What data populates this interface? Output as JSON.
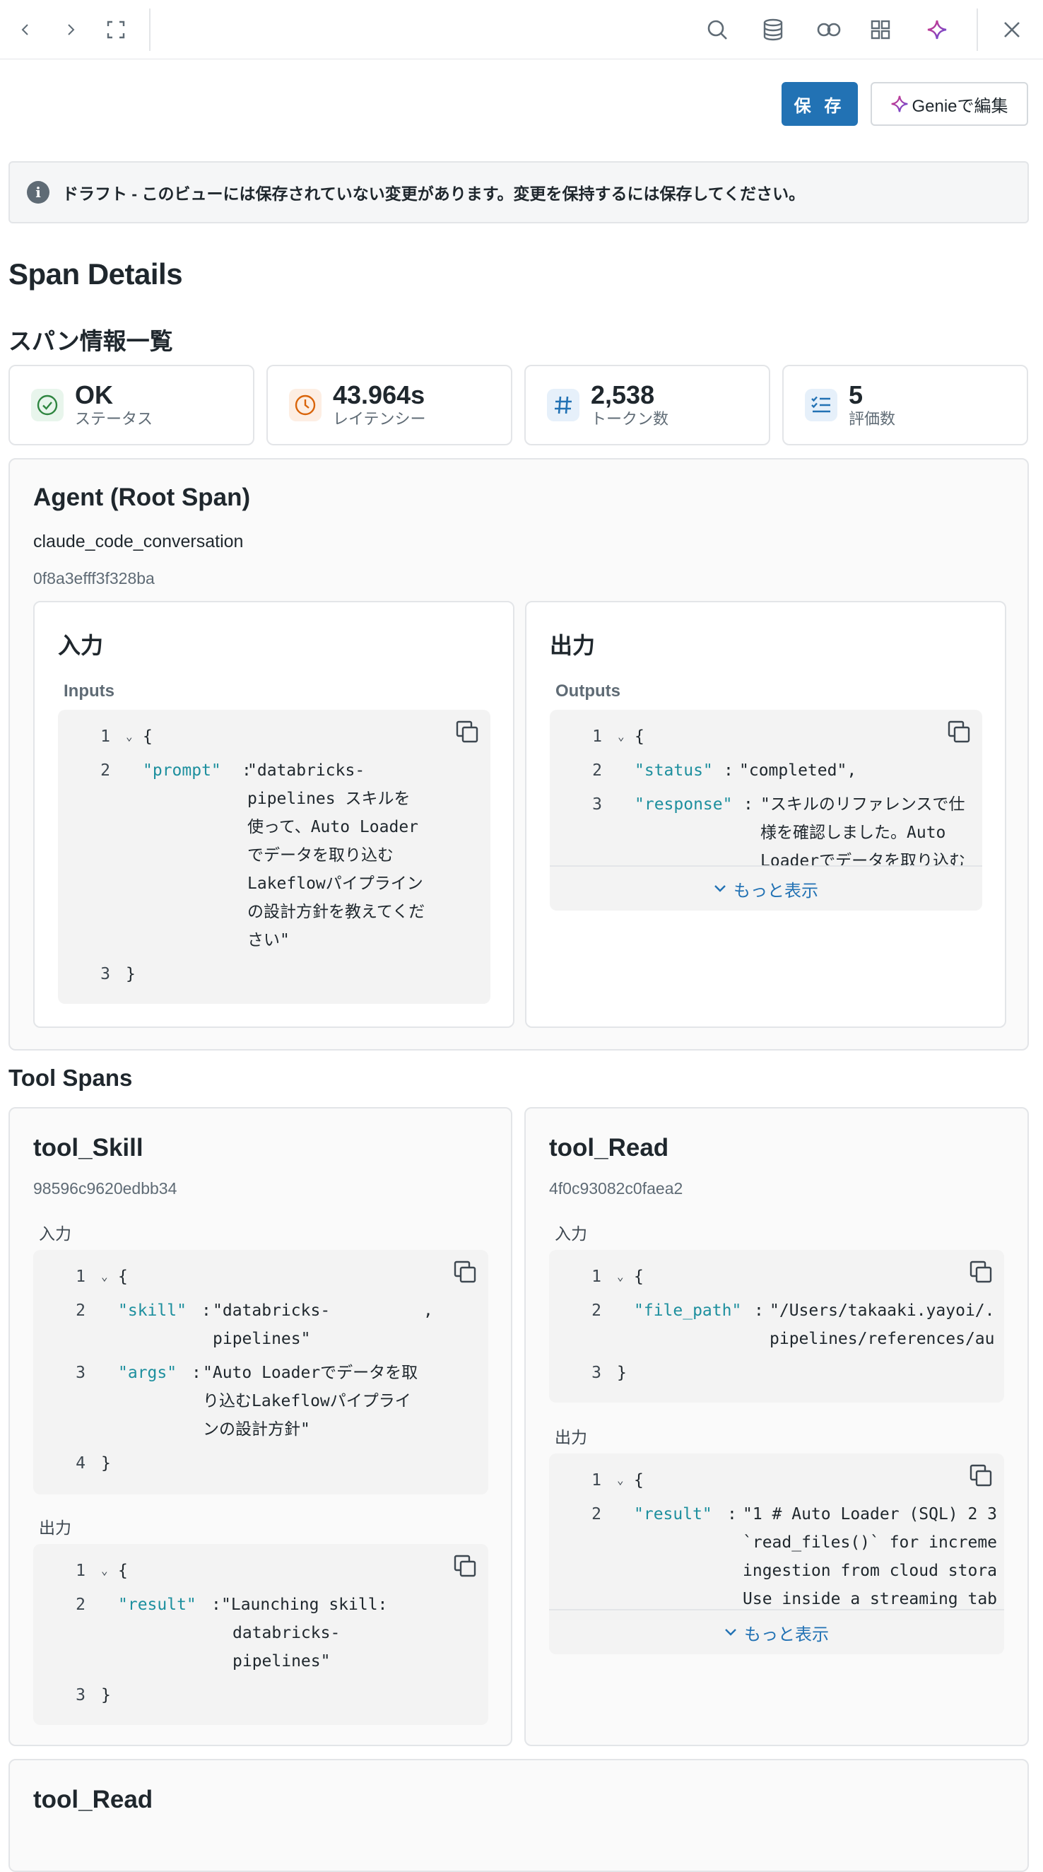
{
  "toolbar": {
    "back_icon": "chevron-left-icon",
    "forward_icon": "chevron-right-icon",
    "fullscreen_icon": "expand-icon",
    "search_icon": "search-icon",
    "database_icon": "database-icon",
    "link_icon": "link-icon",
    "grid_icon": "grid-icon",
    "sparkle_icon": "sparkle-icon",
    "close_icon": "close-icon"
  },
  "actions": {
    "save_label": "保 存",
    "genie_label": "Genieで編集"
  },
  "banner": {
    "text": "ドラフト - このビューには保存されていない変更があります。変更を保持するには保存してください。"
  },
  "page": {
    "title": "Span Details",
    "summary_heading": "スパン情報一覧",
    "tool_spans_heading": "Tool Spans"
  },
  "stats": [
    {
      "value": "OK",
      "label": "ステータス",
      "icon": "check-circle-icon",
      "color": "#2e8540"
    },
    {
      "value": "43.964s",
      "label": "レイテンシー",
      "icon": "clock-icon",
      "color": "#d9640a"
    },
    {
      "value": "2,538",
      "label": "トークン数",
      "icon": "hash-icon",
      "color": "#2272b4"
    },
    {
      "value": "5",
      "label": "評価数",
      "icon": "checklist-icon",
      "color": "#2272b4"
    }
  ],
  "root": {
    "title": "Agent (Root Span)",
    "name": "claude_code_conversation",
    "id": "0f8a3efff3f328ba",
    "input_title": "入力",
    "input_label": "Inputs",
    "output_title": "出力",
    "output_label": "Outputs",
    "input_code": {
      "l1": "{",
      "key2": "\"prompt\"",
      "val2": [
        "\"databricks-",
        "pipelines スキルを",
        "使って、Auto Loader",
        "でデータを取り込む",
        "Lakeflowパイプライン",
        "の設計方針を教えてくだ",
        "さい\""
      ],
      "l3": "}"
    },
    "output_code": {
      "l1": "{",
      "key2": "\"status\"",
      "val2": "\"completed\",",
      "key3": "\"response\"",
      "val3": [
        "\"スキルのリファレンスで仕",
        "様を確認しました。Auto",
        "Loaderでデータを取り込む"
      ],
      "more": "もっと表示"
    }
  },
  "spans": [
    {
      "title": "tool_Skill",
      "id": "98596c9620edbb34",
      "input_label": "入力",
      "output_label": "出力",
      "input_code": {
        "l1": "{",
        "key2": "\"skill\"",
        "val2": [
          "\"databricks-",
          "pipelines\""
        ],
        "comma2": ",",
        "key3": "\"args\"",
        "val3": [
          "\"Auto Loaderでデータを取",
          "り込むLakeflowパイプライ",
          "ンの設計方針\""
        ],
        "l4": "}"
      },
      "output_code": {
        "l1": "{",
        "key2": "\"result\"",
        "val2": [
          "\"Launching skill:",
          "databricks-",
          "pipelines\""
        ],
        "l3": "}"
      }
    },
    {
      "title": "tool_Read",
      "id": "4f0c93082c0faea2",
      "input_label": "入力",
      "output_label": "出力",
      "input_code": {
        "l1": "{",
        "key2": "\"file_path\"",
        "val2": [
          "\"/Users/takaaki.yayoi/.",
          "pipelines/references/au"
        ],
        "l3": "}"
      },
      "output_code": {
        "l1": "{",
        "key2": "\"result\"",
        "val2": [
          "\"1 # Auto Loader (SQL) 2 3",
          "`read_files()` for increme",
          "ingestion from cloud stora",
          "Use inside a streaming tab"
        ],
        "more": "もっと表示"
      }
    },
    {
      "title": "tool_Read"
    }
  ]
}
